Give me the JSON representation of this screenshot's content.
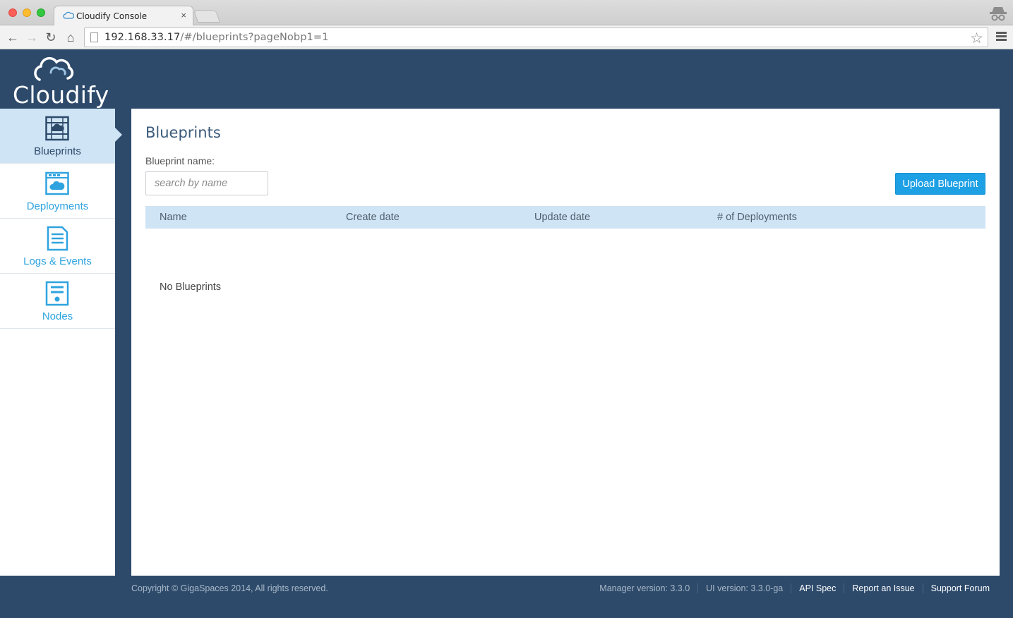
{
  "browser": {
    "tab_title": "Cloudify Console",
    "tab_close": "×",
    "url_host": "192.168.33.17",
    "url_rest": "/#/blueprints?pageNobp1=1"
  },
  "app": {
    "logo_text": "Cloudify"
  },
  "sidebar": {
    "items": [
      {
        "label": "Blueprints",
        "icon": "blueprints-icon",
        "active": true
      },
      {
        "label": "Deployments",
        "icon": "deployments-icon",
        "active": false
      },
      {
        "label": "Logs & Events",
        "icon": "logs-icon",
        "active": false
      },
      {
        "label": "Nodes",
        "icon": "nodes-icon",
        "active": false
      }
    ]
  },
  "main": {
    "title": "Blueprints",
    "search_label": "Blueprint name:",
    "search_placeholder": "search by name",
    "upload_button": "Upload Blueprint",
    "table": {
      "columns": [
        "Name",
        "Create date",
        "Update date",
        "# of Deployments"
      ],
      "empty_message": "No Blueprints"
    }
  },
  "footer": {
    "copyright": "Copyright © GigaSpaces 2014, All rights reserved.",
    "manager_version": "Manager version: 3.3.0",
    "ui_version": "UI version: 3.3.0-ga",
    "api_spec": "API Spec",
    "report_issue": "Report an Issue",
    "support_forum": "Support Forum"
  },
  "colors": {
    "brand_dark": "#2d4a6b",
    "accent_blue": "#1ea0e5",
    "active_bg": "#cfe4f5"
  }
}
